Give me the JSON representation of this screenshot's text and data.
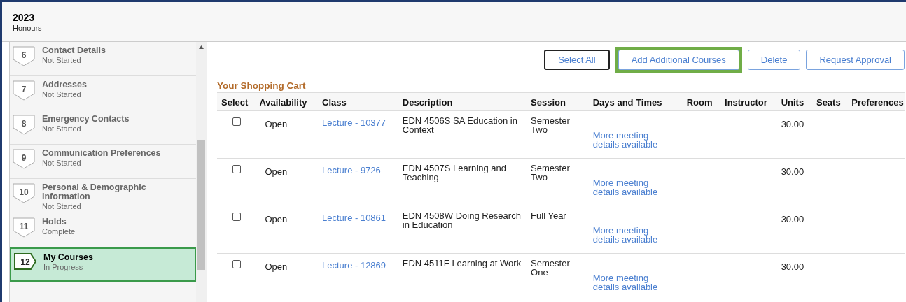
{
  "header": {
    "year": "2023",
    "program": "Honours"
  },
  "steps": [
    {
      "number": "6",
      "title": "Contact Details",
      "status": "Not Started",
      "selected": false
    },
    {
      "number": "7",
      "title": "Addresses",
      "status": "Not Started",
      "selected": false
    },
    {
      "number": "8",
      "title": "Emergency Contacts",
      "status": "Not Started",
      "selected": false
    },
    {
      "number": "9",
      "title": "Communication Preferences",
      "status": "Not Started",
      "selected": false
    },
    {
      "number": "10",
      "title": "Personal & Demographic Information",
      "status": "Not Started",
      "selected": false
    },
    {
      "number": "11",
      "title": "Holds",
      "status": "Complete",
      "selected": false
    },
    {
      "number": "12",
      "title": "My Courses",
      "status": "In Progress",
      "selected": true
    }
  ],
  "buttons": [
    {
      "label": "Select All",
      "focused": true,
      "highlighted": false
    },
    {
      "label": "Add Additional Courses",
      "focused": false,
      "highlighted": true
    },
    {
      "label": "Delete",
      "focused": false,
      "highlighted": false
    },
    {
      "label": "Request Approval",
      "focused": false,
      "highlighted": false
    }
  ],
  "cart": {
    "title": "Your Shopping Cart",
    "columns": [
      "Select",
      "Availability",
      "Class",
      "Description",
      "Session",
      "Days and Times",
      "Room",
      "Instructor",
      "Units",
      "Seats",
      "Preferences"
    ],
    "rows": [
      {
        "checked": false,
        "availability": "Open",
        "class": "Lecture - 10377",
        "description": "EDN 4506S SA Education in Context",
        "session": "Semester Two",
        "days_and_times": "More meeting details available",
        "units": "30.00"
      },
      {
        "checked": false,
        "availability": "Open",
        "class": "Lecture - 9726",
        "description": "EDN 4507S Learning and Teaching",
        "session": "Semester Two",
        "days_and_times": "More meeting details available",
        "units": "30.00"
      },
      {
        "checked": false,
        "availability": "Open",
        "class": "Lecture - 10861",
        "description": "EDN 4508W Doing Research in Education",
        "session": "Full Year",
        "days_and_times": "More meeting details available",
        "units": "30.00"
      },
      {
        "checked": false,
        "availability": "Open",
        "class": "Lecture - 12869",
        "description": "EDN 4511F Learning at Work",
        "session": "Semester One",
        "days_and_times": "More meeting details available",
        "units": "30.00"
      }
    ]
  }
}
